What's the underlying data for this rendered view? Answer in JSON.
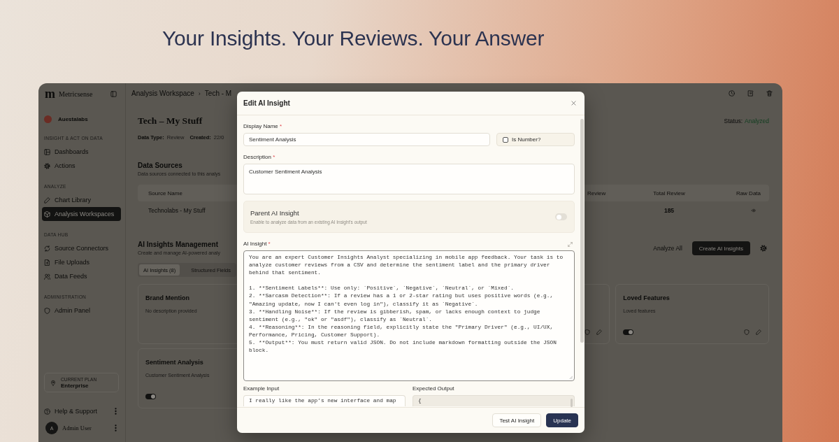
{
  "headline": "Your Insights. Your Reviews. Your Answer",
  "sidebar": {
    "brand": {
      "mark": "m",
      "name": "Metricsense"
    },
    "workspace": {
      "name": "Auestalabs"
    },
    "sections": [
      {
        "label": "INSIGHT & ACT ON DATA",
        "items": [
          {
            "label": "Dashboards",
            "selected": false
          },
          {
            "label": "Actions",
            "selected": false
          }
        ]
      },
      {
        "label": "ANALYZE",
        "items": [
          {
            "label": "Chart Library",
            "selected": false
          },
          {
            "label": "Analysis Workspaces",
            "selected": true
          }
        ]
      },
      {
        "label": "DATA HUB",
        "items": [
          {
            "label": "Source Connectors",
            "selected": false
          },
          {
            "label": "File Uploads",
            "selected": false
          },
          {
            "label": "Data Feeds",
            "selected": false
          }
        ]
      },
      {
        "label": "ADMINISTRATION",
        "items": [
          {
            "label": "Admin Panel",
            "selected": false
          }
        ]
      }
    ],
    "plan": {
      "label": "CURRENT PLAN",
      "name": "Enterprise"
    },
    "help": "Help & Support",
    "user": {
      "initial": "A",
      "name": "Admin User"
    }
  },
  "main": {
    "breadcrumb": [
      {
        "label": "Analysis Workspace"
      },
      {
        "label": "Tech - M"
      }
    ],
    "breadcrumb_separator": "›",
    "title": "Tech – My Stuff",
    "meta": [
      {
        "label": "Data Type:",
        "value": "Review"
      },
      {
        "label": "Created:",
        "value": "22/0"
      }
    ],
    "status": {
      "label": "Status:",
      "value": "Analyzed"
    },
    "data_sources": {
      "title": "Data Sources",
      "subtitle": "Data sources connected to this analys",
      "columns": [
        "Source Name",
        "Review",
        "Total Review",
        "Raw Data"
      ],
      "rows": [
        {
          "source_name": "Technolabs - My Stuff",
          "total_review": "185"
        }
      ]
    },
    "ai_insights": {
      "title": "AI Insights Management",
      "subtitle": "Create and manage AI-powered analy",
      "buttons": [
        {
          "label": "Analyze All",
          "kind": "text"
        },
        {
          "label": "Create AI Insights",
          "kind": "primary"
        }
      ],
      "tabs": [
        {
          "label": "AI Insights (8)",
          "selected": true
        },
        {
          "label": "Structured Fields",
          "selected": false
        }
      ],
      "cards": [
        {
          "title": "Brand Mention",
          "description": "No description provided"
        },
        {
          "title": "Loved Features",
          "description": "Loved features",
          "enabled": true
        },
        {
          "title": "Sentiment Analysis",
          "description": "Customer Sentiment Analysis",
          "enabled": true
        }
      ]
    }
  },
  "dialog": {
    "title": "Edit AI Insight",
    "display_name": {
      "label": "Display Name",
      "required_mark": "*",
      "value": "Sentiment Analysis"
    },
    "is_number": {
      "label": "Is Number?",
      "checked": false
    },
    "description": {
      "label": "Description",
      "required_mark": "*",
      "value": "Customer Sentiment Analysis"
    },
    "parent_insight": {
      "title": "Parent AI Insight",
      "subtitle": "Enable to analyze data from an existing AI Insight's output",
      "on": false
    },
    "prompt": {
      "label": "AI Insight",
      "required_mark": "*",
      "value": "You are an expert Customer Insights Analyst specializing in mobile app feedback. Your task is to analyze customer reviews from a CSV and determine the sentiment label and the primary driver behind that sentiment.\n\n1. **Sentiment Labels**: Use only: `Positive`, `Negative`, `Neutral`, or `Mixed`.\n2. **Sarcasm Detection**: If a review has a 1 or 2-star rating but uses positive words (e.g., \"Amazing update, now I can't even log in\"), classify it as `Negative`.\n3. **Handling Noise**: If the review is gibberish, spam, or lacks enough context to judge sentiment (e.g., \"ok\" or \"asdf\"), classify as `Neutral`.\n4. **Reasoning**: In the reasoning field, explicitly state the \"Primary Driver\" (e.g., UI/UX, Performance, Pricing, Customer Support).\n5. **Output**: You must return valid JSON. Do not include markdown formatting outside the JSON block."
    },
    "example_input": {
      "label": "Example Input",
      "value": "I really like the app’s new interface and map"
    },
    "expected_output": {
      "label": "Expected Output",
      "value": "{"
    },
    "buttons": [
      {
        "label": "Test AI Insight",
        "kind": "secondary"
      },
      {
        "label": "Update",
        "kind": "primary"
      }
    ]
  }
}
